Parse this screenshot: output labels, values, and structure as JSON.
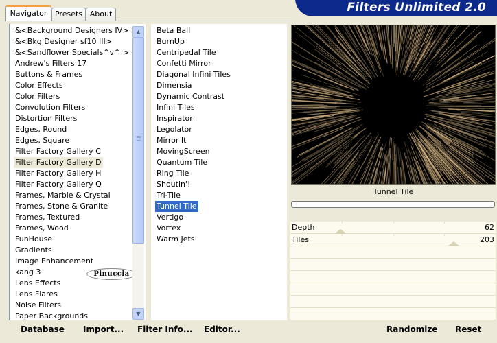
{
  "app": {
    "title": "Filters Unlimited 2.0"
  },
  "tabs": [
    {
      "label": "Navigator",
      "active": true
    },
    {
      "label": "Presets",
      "active": false
    },
    {
      "label": "About",
      "active": false
    }
  ],
  "categories": {
    "selected": "Filter Factory Gallery D",
    "items": [
      "&<Background Designers IV>",
      "&<Bkg Designer sf10 III>",
      "&<Sandflower Specials^v^ >",
      "Andrew's Filters 17",
      "Buttons & Frames",
      "Color Effects",
      "Color Filters",
      "Convolution Filters",
      "Distortion Filters",
      "Edges, Round",
      "Edges, Square",
      "Filter Factory Gallery C",
      "Filter Factory Gallery D",
      "Filter Factory Gallery H",
      "Filter Factory Gallery Q",
      "Frames, Marble & Crystal",
      "Frames, Stone & Granite",
      "Frames, Textured",
      "Frames, Wood",
      "FunHouse",
      "Gradients",
      "Image Enhancement",
      "kang 3",
      "Lens Effects",
      "Lens Flares",
      "Noise Filters",
      "Paper Backgrounds"
    ]
  },
  "filters": {
    "selected": "Tunnel Tile",
    "items": [
      "Beta Ball",
      "BurnUp",
      "Centripedal Tile",
      "Confetti Mirror",
      "Diagonal Infini Tiles",
      "Dimensia",
      "Dynamic Contrast",
      "Infini Tiles",
      "Inspirator",
      "Legolator",
      "Mirror It",
      "MovingScreen",
      "Quantum Tile",
      "Ring Tile",
      "Shoutin'!",
      "Tri-Tile",
      "Tunnel Tile",
      "Vertigo",
      "Vortex",
      "Warm Jets"
    ]
  },
  "watermark": {
    "text": "Pinuccia"
  },
  "preview": {
    "filter_name": "Tunnel Tile",
    "progress": 0
  },
  "parameters": [
    {
      "label": "Depth",
      "value": "62",
      "level": 0.243
    },
    {
      "label": "Tiles",
      "value": "203",
      "level": 0.796
    }
  ],
  "buttons": {
    "database": {
      "underline": "D",
      "rest": "atabase"
    },
    "import": {
      "underline": "I",
      "rest": "mport..."
    },
    "filter_info": {
      "pre": "Filter ",
      "underline": "I",
      "rest": "nfo..."
    },
    "editor": {
      "underline": "E",
      "rest": "ditor..."
    },
    "randomize": "Randomize",
    "reset": "Reset"
  },
  "icons": {
    "scroll_up": "scroll-up-arrow-icon",
    "scroll_down": "scroll-down-arrow-icon",
    "scroll_grip": "scroll-grip-icon"
  },
  "colors": {
    "selection": "#316ac5",
    "banner": "#0b2a8c",
    "window": "#ece9d8",
    "tab_accent": "#f2a03e"
  }
}
